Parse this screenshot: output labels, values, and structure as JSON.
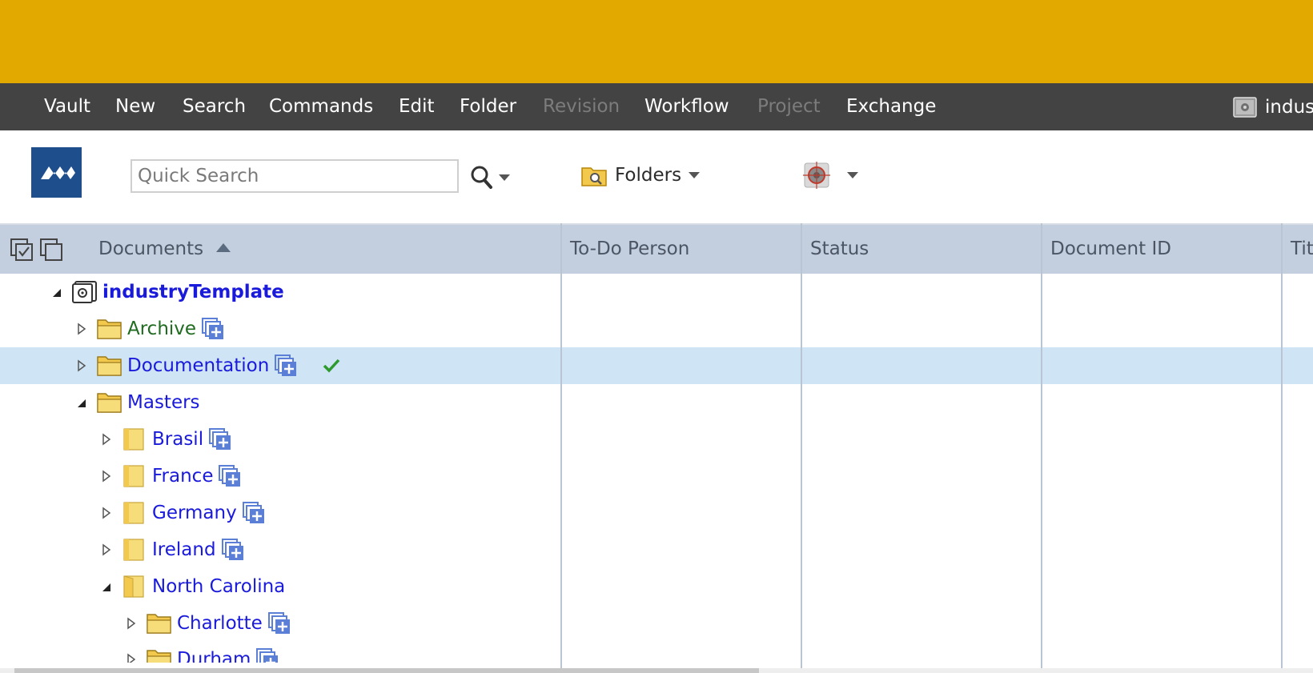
{
  "menubar": {
    "items": [
      {
        "label": "Vault",
        "enabled": true
      },
      {
        "label": "New",
        "enabled": true
      },
      {
        "label": "Search",
        "enabled": true
      },
      {
        "label": "Commands",
        "enabled": true
      },
      {
        "label": "Edit",
        "enabled": true
      },
      {
        "label": "Folder",
        "enabled": true
      },
      {
        "label": "Revision",
        "enabled": false
      },
      {
        "label": "Workflow",
        "enabled": true
      },
      {
        "label": "Project",
        "enabled": false
      },
      {
        "label": "Exchange",
        "enabled": true
      }
    ],
    "user_vault": "indus"
  },
  "toolbar": {
    "search_placeholder": "Quick Search",
    "view_label": "Folders"
  },
  "grid": {
    "columns": [
      "Documents",
      "To-Do Person",
      "Status",
      "Document ID",
      "Tit"
    ],
    "sort_column": "Documents",
    "sort_direction": "ascending",
    "tree": [
      {
        "label": "industryTemplate",
        "type": "vault",
        "expanded": true,
        "level": 0
      },
      {
        "label": "Archive",
        "type": "folder",
        "expanded": false,
        "level": 1,
        "color": "#1f6b1f"
      },
      {
        "label": "Documentation",
        "type": "folder",
        "expanded": false,
        "level": 1,
        "selected": true,
        "checked": true
      },
      {
        "label": "Masters",
        "type": "folder",
        "expanded": true,
        "level": 1
      },
      {
        "label": "Brasil",
        "type": "project",
        "expanded": false,
        "level": 2
      },
      {
        "label": "France",
        "type": "project",
        "expanded": false,
        "level": 2
      },
      {
        "label": "Germany",
        "type": "project",
        "expanded": false,
        "level": 2
      },
      {
        "label": "Ireland",
        "type": "project",
        "expanded": false,
        "level": 2
      },
      {
        "label": "North Carolina",
        "type": "project",
        "expanded": true,
        "level": 2
      },
      {
        "label": "Charlotte",
        "type": "folder",
        "expanded": false,
        "level": 3
      },
      {
        "label": "Durham",
        "type": "folder",
        "expanded": false,
        "level": 3
      }
    ]
  },
  "colors": {
    "brand_band": "#e2a900",
    "menubar_bg": "#434343",
    "grid_header_bg": "#c3cfdf",
    "selected_row_bg": "#cfe5f5",
    "link_blue": "#1a1adb"
  }
}
